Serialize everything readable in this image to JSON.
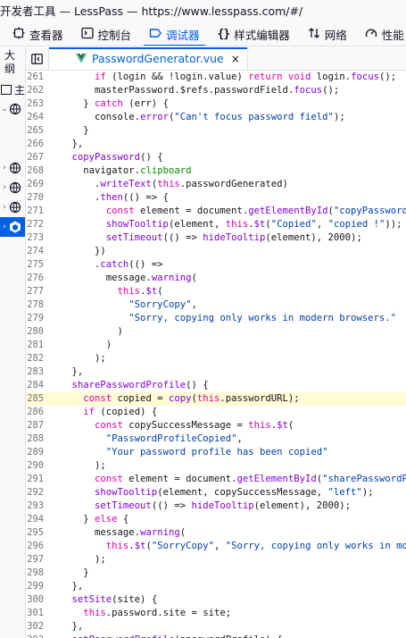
{
  "window": {
    "title": "开发者工具 — LessPass — https://www.lesspass.com/#/"
  },
  "toolbar": {
    "tabs": [
      {
        "label": "查看器",
        "icon": "inspector-icon"
      },
      {
        "label": "控制台",
        "icon": "console-icon"
      },
      {
        "label": "调试器",
        "icon": "debugger-icon",
        "active": true
      },
      {
        "label": "样式编辑器",
        "icon": "style-editor-icon"
      },
      {
        "label": "网络",
        "icon": "network-icon"
      },
      {
        "label": "性能",
        "icon": "performance-icon"
      }
    ]
  },
  "sidebar": {
    "outline_label": "大纲",
    "main_label": "主",
    "selected_color": "#0061e0"
  },
  "editor_tab": {
    "filename": "PasswordGenerator.vue",
    "close": "×"
  },
  "highlight_line": 285,
  "code_lines": [
    {
      "n": "261",
      "html": "        <span class=\"k\">if</span> (login &amp;&amp; !login.value) <span class=\"k\">return void</span> login.<span class=\"f\">focus</span>();"
    },
    {
      "n": "262",
      "html": "        masterPassword.$refs.passwordField.<span class=\"f\">focus</span>();"
    },
    {
      "n": "263",
      "html": "      } <span class=\"k\">catch</span> (err) {"
    },
    {
      "n": "264",
      "html": "        console.<span class=\"f\">error</span>(<span class=\"s\">\"Can't focus password field\"</span>);"
    },
    {
      "n": "265",
      "html": "      }"
    },
    {
      "n": "266",
      "html": "    },"
    },
    {
      "n": "267",
      "html": "    <span class=\"f\">copyPassword</span>() {"
    },
    {
      "n": "268",
      "html": "      navigator.<span class=\"p\">clipboard</span>"
    },
    {
      "n": "269",
      "html": "        .<span class=\"f\">writeText</span>(<span class=\"k\">this</span>.passwordGenerated)"
    },
    {
      "n": "270",
      "html": "        .<span class=\"f\">then</span>(() =&gt; {"
    },
    {
      "n": "271",
      "html": "          <span class=\"k\">const</span> element = document.<span class=\"f\">getElementById</span>(<span class=\"s\">\"copyPasswordButton\"</span>);"
    },
    {
      "n": "272",
      "html": "          <span class=\"f\">showTooltip</span>(element, <span class=\"k\">this</span>.<span class=\"f\">$t</span>(<span class=\"s\">\"Copied\"</span>, <span class=\"s\">\"copied !\"</span>));"
    },
    {
      "n": "273",
      "html": "          <span class=\"f\">setTimeout</span>(() =&gt; <span class=\"f\">hideTooltip</span>(element), 2000);"
    },
    {
      "n": "274",
      "html": "        })"
    },
    {
      "n": "275",
      "html": "        .<span class=\"f\">catch</span>(() =&gt;"
    },
    {
      "n": "276",
      "html": "          message.<span class=\"f\">warning</span>("
    },
    {
      "n": "277",
      "html": "            <span class=\"k\">this</span>.<span class=\"f\">$t</span>("
    },
    {
      "n": "278",
      "html": "              <span class=\"s\">\"SorryCopy\"</span>,"
    },
    {
      "n": "279",
      "html": "              <span class=\"s\">\"Sorry, copying only works in modern browsers.\"</span>"
    },
    {
      "n": "280",
      "html": "            )"
    },
    {
      "n": "281",
      "html": "          )"
    },
    {
      "n": "282",
      "html": "        );"
    },
    {
      "n": "283",
      "html": "    },"
    },
    {
      "n": "284",
      "html": "    <span class=\"f\">sharePasswordProfile</span>() {"
    },
    {
      "n": "285",
      "html": "      <span class=\"k\">const</span> copied = <span class=\"f\">copy</span>(<span class=\"k\">this</span>.passwordURL);"
    },
    {
      "n": "286",
      "html": "      <span class=\"k\">if</span> (copied) {"
    },
    {
      "n": "287",
      "html": "        <span class=\"k\">const</span> copySuccessMessage = <span class=\"k\">this</span>.<span class=\"f\">$t</span>("
    },
    {
      "n": "288",
      "html": "          <span class=\"s\">\"PasswordProfileCopied\"</span>,"
    },
    {
      "n": "289",
      "html": "          <span class=\"s\">\"Your password profile has been copied\"</span>"
    },
    {
      "n": "290",
      "html": "        );"
    },
    {
      "n": "291",
      "html": "        <span class=\"k\">const</span> element = document.<span class=\"f\">getElementById</span>(<span class=\"s\">\"sharePasswordProfileButton\"</span>);"
    },
    {
      "n": "292",
      "html": "        <span class=\"f\">showTooltip</span>(element, copySuccessMessage, <span class=\"s\">\"left\"</span>);"
    },
    {
      "n": "293",
      "html": "        <span class=\"f\">setTimeout</span>(() =&gt; <span class=\"f\">hideTooltip</span>(element), 2000);"
    },
    {
      "n": "294",
      "html": "      } <span class=\"k\">else</span> {"
    },
    {
      "n": "295",
      "html": "        message.<span class=\"f\">warning</span>("
    },
    {
      "n": "296",
      "html": "          <span class=\"k\">this</span>.<span class=\"f\">$t</span>(<span class=\"s\">\"SorryCopy\"</span>, <span class=\"s\">\"Sorry, copying only works in modern browsers.\"</span>)"
    },
    {
      "n": "297",
      "html": "        );"
    },
    {
      "n": "298",
      "html": "      }"
    },
    {
      "n": "299",
      "html": "    },"
    },
    {
      "n": "300",
      "html": "    <span class=\"f\">setSite</span>(site) {"
    },
    {
      "n": "301",
      "html": "      <span class=\"k\">this</span>.password.site = site;"
    },
    {
      "n": "302",
      "html": "    },"
    },
    {
      "n": "303",
      "html": "    <span class=\"f\">setPasswordProfile</span>(passwordProfile) {"
    }
  ]
}
